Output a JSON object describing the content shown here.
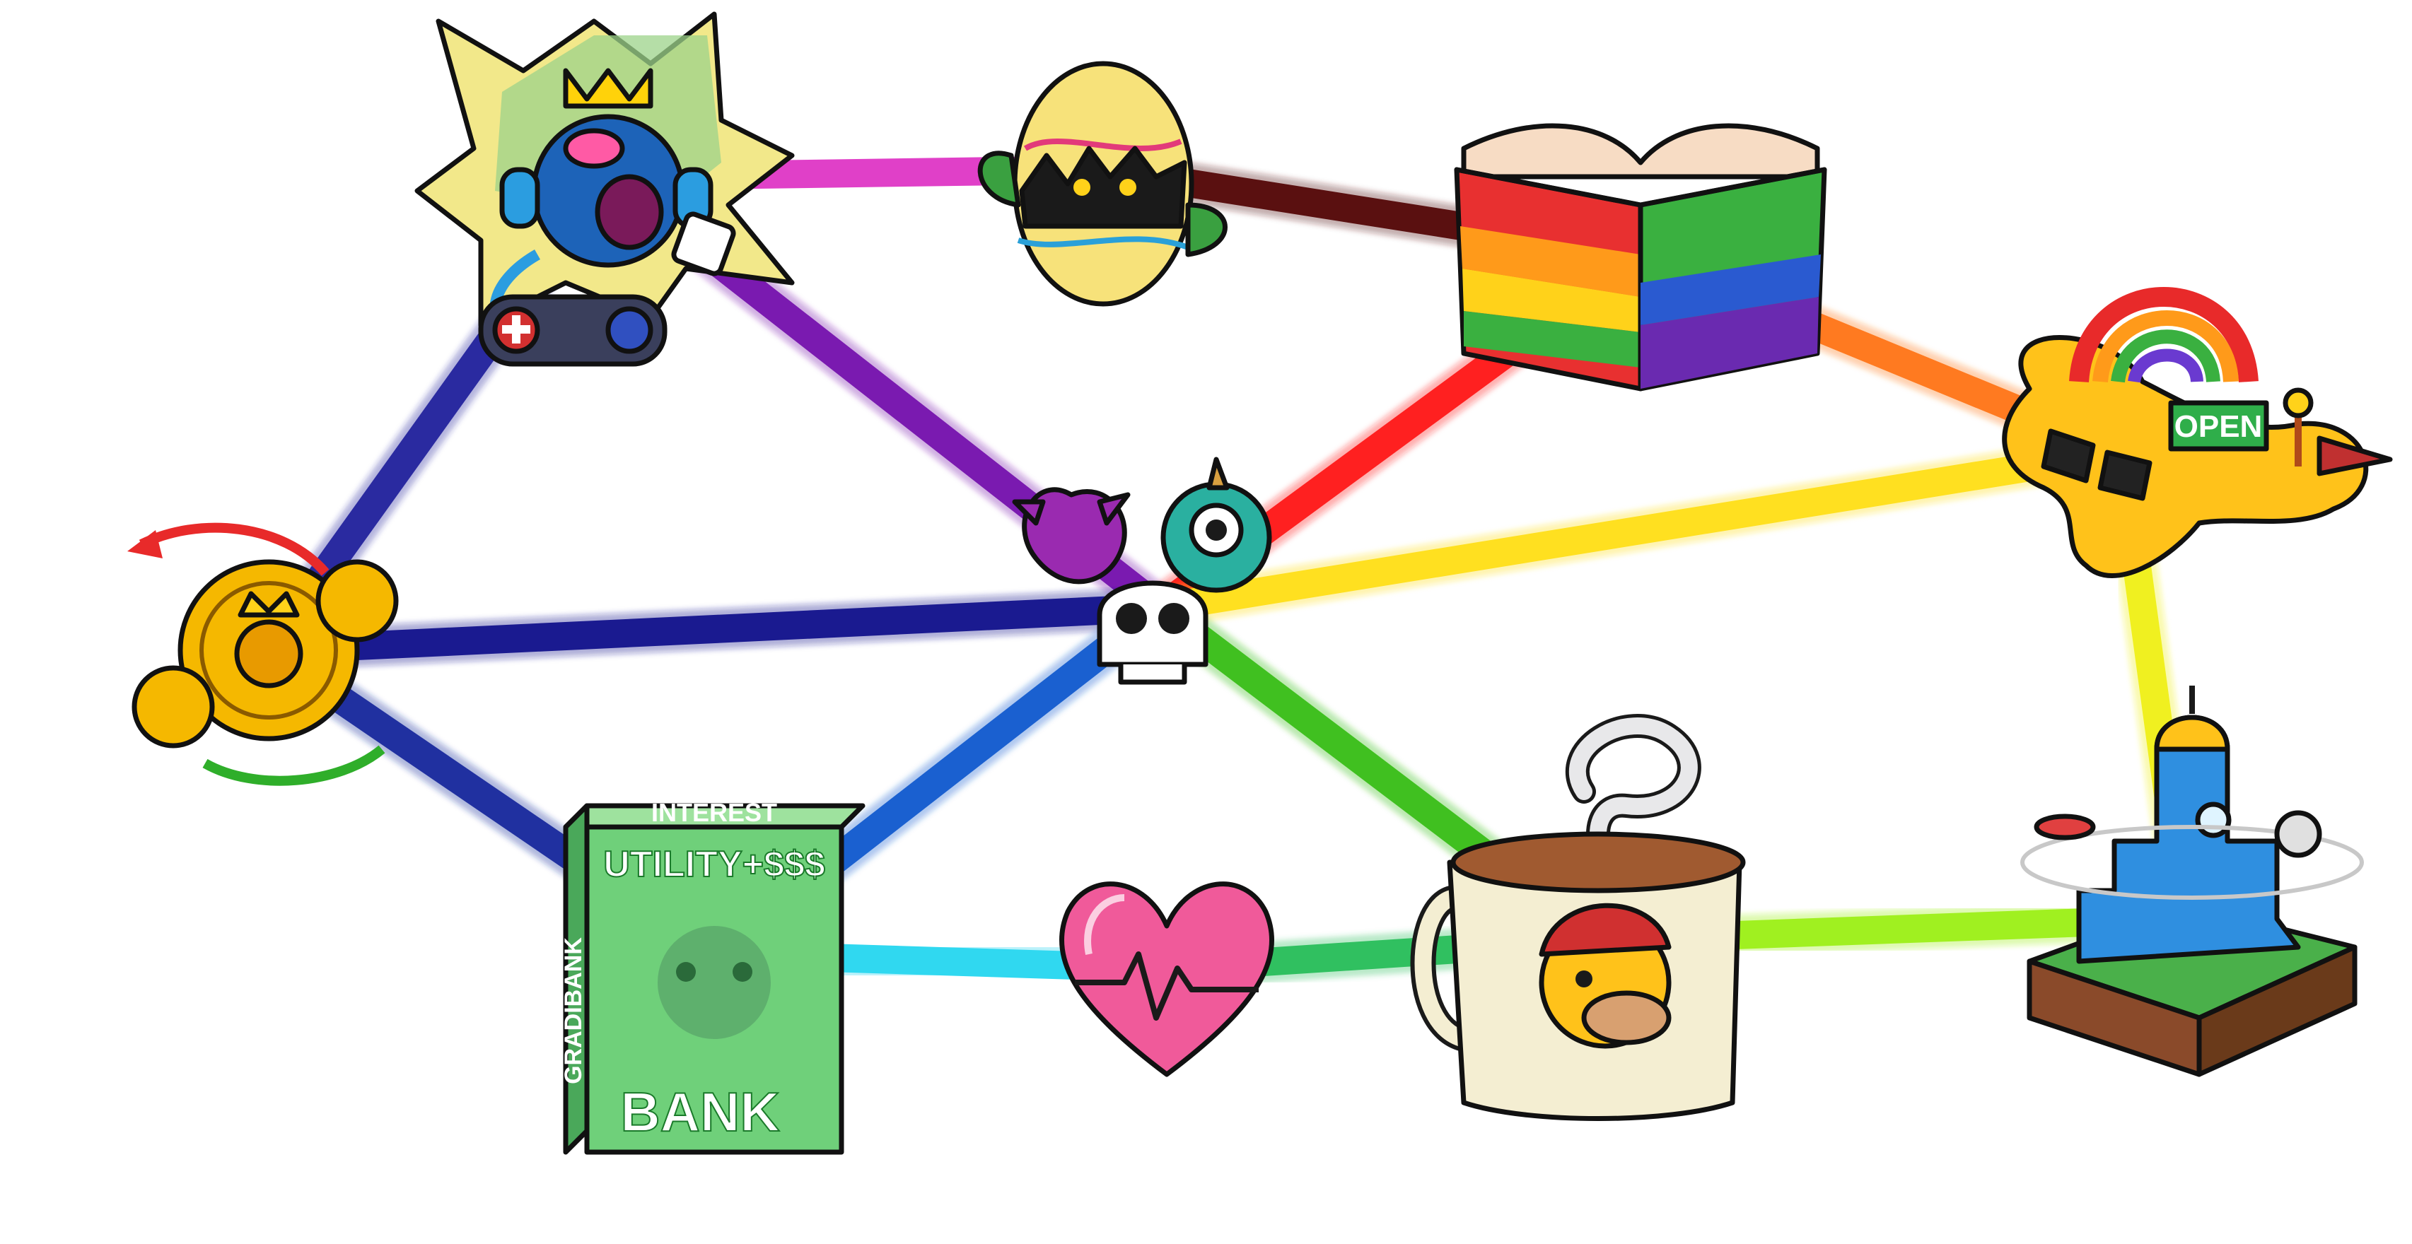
{
  "nodes": [
    {
      "id": "arcade",
      "icon": "arcade-gamepad-icon"
    },
    {
      "id": "egg",
      "icon": "cracked-egg-icon"
    },
    {
      "id": "book",
      "icon": "rainbow-book-icon"
    },
    {
      "id": "shop",
      "icon": "rainbow-shop-blob-icon",
      "sign": "OPEN"
    },
    {
      "id": "coins",
      "icon": "royal-coins-icon"
    },
    {
      "id": "monsters",
      "icon": "monsters-skull-icon"
    },
    {
      "id": "bank",
      "icon": "gradibank-box-icon",
      "top_text": "INTEREST",
      "front_text": "UTILITY+$$$",
      "side_text": "GRADIBANK",
      "bottom_text": "BANK"
    },
    {
      "id": "heart",
      "icon": "heartbeat-heart-icon"
    },
    {
      "id": "mug",
      "icon": "platypus-coffee-mug-icon"
    },
    {
      "id": "castle",
      "icon": "space-castle-icon"
    }
  ],
  "edges": [
    {
      "from": "arcade",
      "to": "egg",
      "color": "#e040c8"
    },
    {
      "from": "egg",
      "to": "book",
      "color": "#5a1010"
    },
    {
      "from": "book",
      "to": "shop",
      "color": "#ff7a20"
    },
    {
      "from": "arcade",
      "to": "coins",
      "color": "#2a2aa0"
    },
    {
      "from": "arcade",
      "to": "monsters",
      "color": "#7a1ab0"
    },
    {
      "from": "book",
      "to": "monsters",
      "color": "#ff2020"
    },
    {
      "from": "shop",
      "to": "monsters",
      "color": "#ffe020"
    },
    {
      "from": "shop",
      "to": "castle",
      "color": "#f0f020"
    },
    {
      "from": "coins",
      "to": "monsters",
      "color": "#1a1a90"
    },
    {
      "from": "coins",
      "to": "bank",
      "color": "#2030a0"
    },
    {
      "from": "bank",
      "to": "monsters",
      "color": "#1a60d0"
    },
    {
      "from": "monsters",
      "to": "mug",
      "color": "#40c020"
    },
    {
      "from": "bank",
      "to": "heart",
      "color": "#30d8f0"
    },
    {
      "from": "heart",
      "to": "mug",
      "color": "#30c060"
    },
    {
      "from": "mug",
      "to": "castle",
      "color": "#a0f020"
    }
  ],
  "colors": {
    "background": "#ffffff",
    "outline": "#111111",
    "coin_gold": "#f5b800",
    "bank_green": "#6fd07a",
    "heart_pink": "#f05a9a",
    "shop_yellow": "#ffc21a",
    "castle_blue": "#2f8fe0"
  }
}
